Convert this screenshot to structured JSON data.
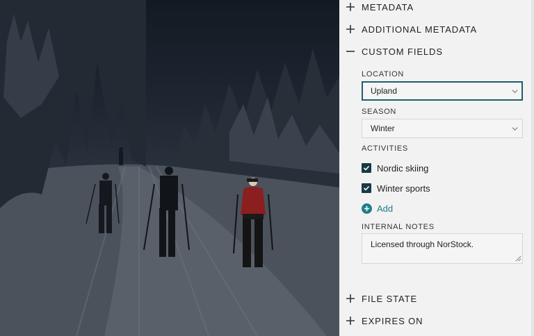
{
  "sections": {
    "metadata": {
      "label": "METADATA",
      "expanded": false
    },
    "additional_metadata": {
      "label": "ADDITIONAL METADATA",
      "expanded": false
    },
    "custom_fields": {
      "label": "CUSTOM FIELDS",
      "expanded": true
    },
    "file_state": {
      "label": "FILE STATE",
      "expanded": false
    },
    "expires_on": {
      "label": "EXPIRES ON",
      "expanded": false
    }
  },
  "custom_fields": {
    "location": {
      "label": "LOCATION",
      "value": "Upland"
    },
    "season": {
      "label": "SEASON",
      "value": "Winter"
    },
    "activities": {
      "label": "ACTIVITIES",
      "items": [
        {
          "label": "Nordic skiing",
          "checked": true
        },
        {
          "label": "Winter sports",
          "checked": true
        }
      ],
      "add_label": "Add"
    },
    "internal_notes": {
      "label": "INTERNAL NOTES",
      "value": "Licensed through NorStock."
    }
  },
  "colors": {
    "accent": "#1f7e89",
    "checkbox": "#173a46",
    "focus_border": "#1f5e6e",
    "panel_bg": "#f2f2f2"
  },
  "icons": {
    "expand": "plus-icon",
    "collapse": "minus-icon",
    "dropdown": "chevron-down-icon",
    "check": "checkmark-icon",
    "add": "plus-circle-icon",
    "resize": "resize-grip-icon"
  }
}
